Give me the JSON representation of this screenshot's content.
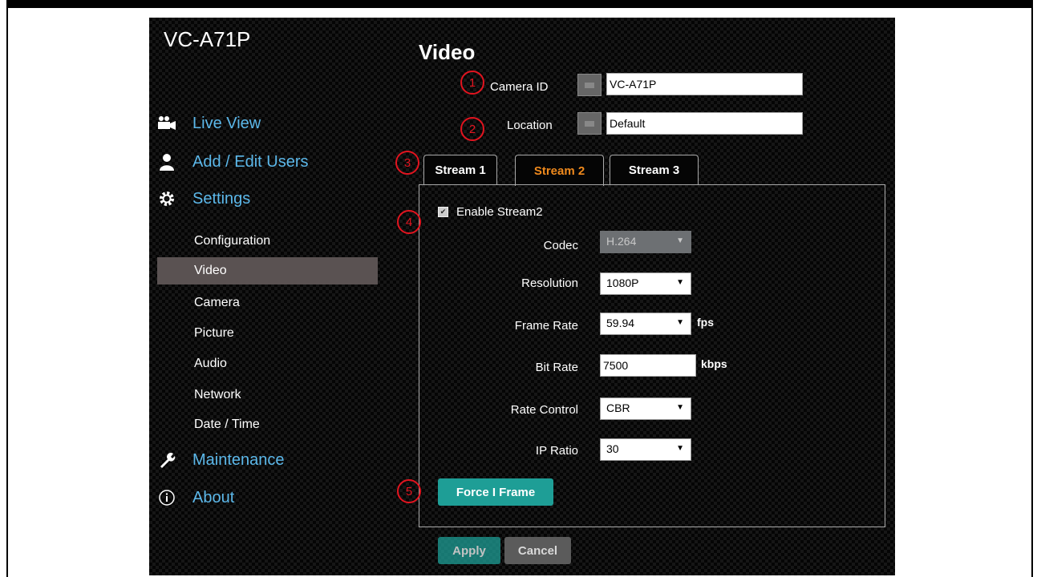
{
  "app": {
    "model": "VC-A71P"
  },
  "nav": {
    "main": [
      {
        "label": "Live View",
        "icon": "video-camera-icon"
      },
      {
        "label": "Add / Edit Users",
        "icon": "user-icon"
      },
      {
        "label": "Settings",
        "icon": "gear-icon"
      },
      {
        "label": "Maintenance",
        "icon": "wrench-icon"
      },
      {
        "label": "About",
        "icon": "info-icon"
      }
    ],
    "sub": [
      {
        "label": "Configuration",
        "active": false
      },
      {
        "label": "Video",
        "active": true
      },
      {
        "label": "Camera",
        "active": false
      },
      {
        "label": "Picture",
        "active": false
      },
      {
        "label": "Audio",
        "active": false
      },
      {
        "label": "Network",
        "active": false
      },
      {
        "label": "Date / Time",
        "active": false
      }
    ]
  },
  "page": {
    "title": "Video",
    "camera_id_label": "Camera ID",
    "camera_id_value": "VC-A71P",
    "location_label": "Location",
    "location_value": "Default"
  },
  "tabs": [
    {
      "label": "Stream 1",
      "active": false
    },
    {
      "label": "Stream 2",
      "active": true
    },
    {
      "label": "Stream 3",
      "active": false
    }
  ],
  "stream": {
    "enable_label": "Enable Stream2",
    "enabled": true,
    "codec_label": "Codec",
    "codec_value": "H.264",
    "resolution_label": "Resolution",
    "resolution_value": "1080P",
    "frame_rate_label": "Frame Rate",
    "frame_rate_value": "59.94",
    "frame_rate_unit": "fps",
    "bit_rate_label": "Bit Rate",
    "bit_rate_value": "7500",
    "bit_rate_unit": "kbps",
    "rate_control_label": "Rate Control",
    "rate_control_value": "CBR",
    "ip_ratio_label": "IP Ratio",
    "ip_ratio_value": "30",
    "force_iframe_label": "Force I Frame"
  },
  "footer": {
    "apply_label": "Apply",
    "cancel_label": "Cancel"
  },
  "callouts": [
    "1",
    "2",
    "3",
    "4",
    "5"
  ],
  "colors": {
    "accent_tab": "#f08a1d",
    "nav_link": "#5cb8ea",
    "button_teal": "#1e9e96",
    "callout_red": "#e2141f"
  }
}
